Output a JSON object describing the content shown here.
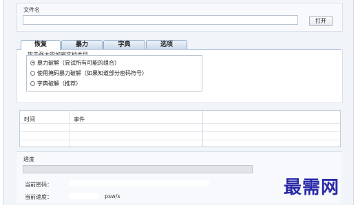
{
  "file": {
    "label": "文件名",
    "value": "",
    "open_label": "打开"
  },
  "tabs": [
    {
      "label": "恢复",
      "active": true
    },
    {
      "label": "暴力",
      "active": false
    },
    {
      "label": "字典",
      "active": false
    },
    {
      "label": "选项",
      "active": false
    }
  ],
  "attack": {
    "title": "攻击强大的加密文档类型",
    "options": [
      {
        "label": "暴力破解（尝试所有可能的组合）",
        "selected": true
      },
      {
        "label": "使用掩码暴力破解（如果知道部分密码符号）",
        "selected": false
      },
      {
        "label": "字典破解（推荐）",
        "selected": false
      }
    ]
  },
  "log": {
    "columns": [
      "时间",
      "事件"
    ],
    "rows": []
  },
  "progress": {
    "label": "进度",
    "percent": 0,
    "current_password_label": "当前密码：",
    "current_password_value": "",
    "current_speed_label": "当前速度：",
    "current_speed_value": "",
    "speed_unit": "psw/s"
  },
  "watermark": "最需网",
  "colors": {
    "accent": "#8fa9c8",
    "watermark": "#2a2aa8"
  }
}
